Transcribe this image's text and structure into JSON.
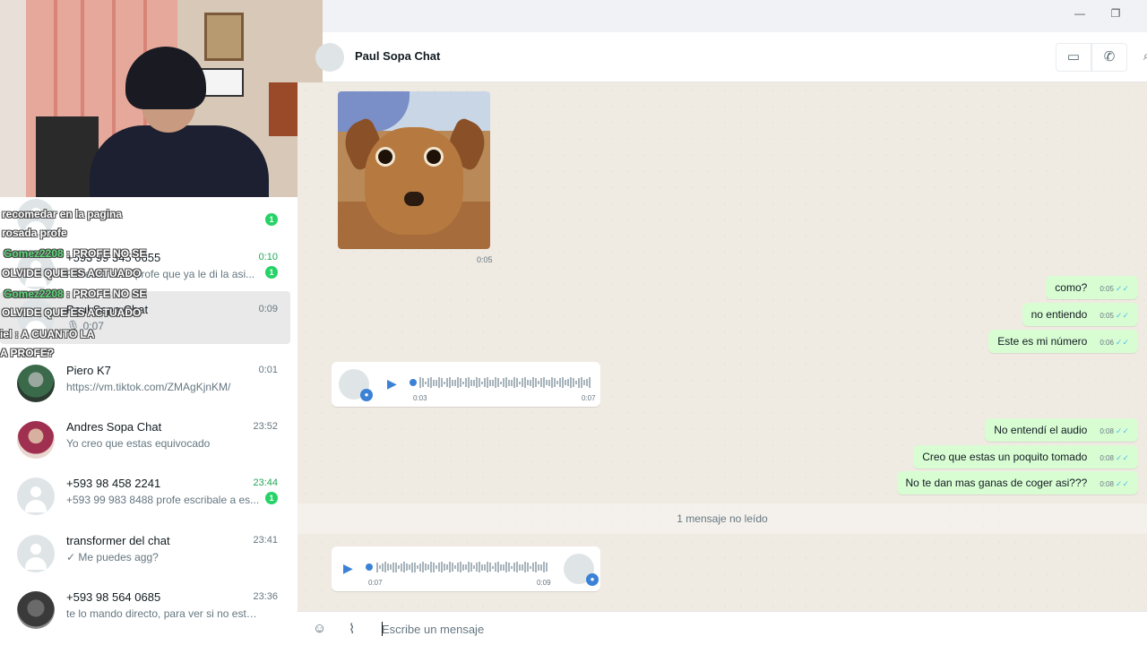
{
  "window": {
    "minimize_icon": "minimize-icon",
    "maximize_icon": "restore-icon"
  },
  "header": {
    "title": "Paul Sopa Chat",
    "video_icon": "video-icon",
    "call_icon": "phone-icon",
    "search_icon": "search-icon"
  },
  "sidebar": {
    "chats": [
      {
        "name": "",
        "time": "",
        "preview": "",
        "unread": "1"
      },
      {
        "name": "+593 99 345 0655",
        "time": "0:10",
        "preview": "Páseme la 10 profe que ya le di la asi...",
        "unread": "1"
      },
      {
        "name": "Paul Sopa Chat",
        "time": "0:09",
        "preview": "🎙 0:07",
        "unread": ""
      },
      {
        "name": "Piero K7",
        "time": "0:01",
        "preview": "https://vm.tiktok.com/ZMAgKjnKM/",
        "unread": ""
      },
      {
        "name": "Andres Sopa Chat",
        "time": "23:52",
        "preview": "Yo creo que estas equivocado",
        "unread": ""
      },
      {
        "name": "+593 98 458 2241",
        "time": "23:44",
        "preview": "+593 99 983 8488 profe escribale a es...",
        "unread": "1"
      },
      {
        "name": "transformer del chat",
        "time": "23:41",
        "preview": "✓ Me puedes agg?",
        "unread": ""
      },
      {
        "name": "+593 98 564 0685",
        "time": "23:36",
        "preview": "te lo mando directo, para ver si no esta ...",
        "unread": ""
      }
    ]
  },
  "overlay_chat": [
    {
      "user": "",
      "text": "recomedar en la pagina"
    },
    {
      "user": "",
      "text": "rosada profe"
    },
    {
      "user": "Gomez2208",
      "text": " : PROFE NO SE"
    },
    {
      "user": "",
      "text": "OLVIDE QUE ES ACTUADO"
    },
    {
      "user": "Gomez2208",
      "text": " : PROFE NO SE"
    },
    {
      "user": "",
      "text": "OLVIDE QUE ES ACTUADO"
    },
    {
      "user": "",
      "text": "iel : A CUANTO LA"
    },
    {
      "user": "",
      "text": "A PROFE?"
    }
  ],
  "messages": {
    "image_time": "0:05",
    "outgoing": [
      {
        "text": "como?",
        "time": "0:05"
      },
      {
        "text": "no entiendo",
        "time": "0:05"
      },
      {
        "text": "Este es mi número",
        "time": "0:06"
      },
      {
        "text": "No entendí el audio",
        "time": "0:08"
      },
      {
        "text": "Creo que estas un poquito tomado",
        "time": "0:08"
      },
      {
        "text": "No te dan mas ganas de coger asi???",
        "time": "0:08"
      }
    ],
    "audio1": {
      "elapsed": "0:03",
      "duration": "0:07"
    },
    "audio2": {
      "elapsed": "0:07",
      "duration": "0:09"
    },
    "unread_divider": "1 mensaje no leído"
  },
  "composer": {
    "placeholder": "Escribe un mensaje",
    "emoji_icon": "emoji-icon",
    "attach_icon": "paperclip-icon"
  },
  "colors": {
    "outgoing_bubble": "#d9fdd3",
    "accent": "#25d366",
    "audio_blue": "#3b82d6"
  }
}
